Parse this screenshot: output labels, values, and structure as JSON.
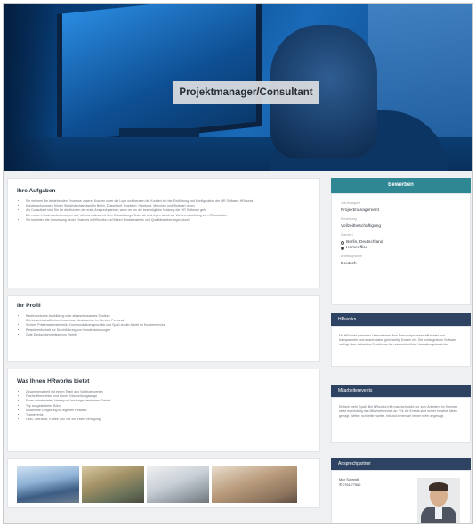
{
  "hero": {
    "title": "Projektmanager/Consultant"
  },
  "tasks": {
    "heading": "Ihre Aufgaben",
    "items": [
      "Sie nehmen die bestehenden Prozesse unserer Kunden unter die Lupe und beraten die Kunden bei der Einführung und Konfiguration der HR Software HRworks",
      "Kundenschulungen führen Sie deutschlandweit in Berlin, Düsseldorf, Frankfurt, Hamburg, München und Stuttgart durch",
      "Als Consultant sind Sie für die Kunden der erste Ansprechpartner, wenn es um die bestmögliche Nutzung der HR Software geht",
      "Die neuen Kundenanforderungen auf, stimmen diese mit dem Entwicklungs-Team ab und legen damit zur Weiterentwicklung von HRworks bei",
      "Sie begleiten die Umsetzung neuer Features in HRworks und führen Funktionstests und Qualitätssicherungen durch"
    ]
  },
  "profile": {
    "heading": "Ihr Profil",
    "items": [
      "Kaufmännische Ausbildung oder abgeschlossenes Studium",
      "Betriebswirtschaftliches Know-how, idealerweise im Bereich Personal",
      "Sichere Präsentationstechnik, Kommunikationsgeschick und Spaß an der Arbeit im Kundenservice",
      "Reisebereitschaft zur Durchführung von Kundenschulungen",
      "Gute Deutschkenntnisse von Vorteil"
    ]
  },
  "offer": {
    "heading": "Was Ihnen HRworks bietet",
    "items": [
      "Zusammenarbeit mit einem Team aus Vollblutexperten",
      "Flache Hierarchien und kurze Entscheidungswege",
      "Einen unbefristeten Vertrag mit leistungsorientiertem Gehalt",
      "Top ausgestattetes Büro",
      "Modernste Umgebung im eigenen Headset",
      "Teamevents",
      "Obst, Getränke, Kaffee und Tee zur freien Verfügung"
    ]
  },
  "apply": {
    "button_label": "Bewerben"
  },
  "details": {
    "category_label": "Job-Kategorie",
    "category_value": "Projektmanagement",
    "type_label": "Einstellung",
    "type_value": "Vollzeitbeschäftigung",
    "location_label": "Standort",
    "location_options": [
      "Berlin, Deutschland",
      "Homeoffice"
    ],
    "location_selected": 1,
    "language_label": "Arbeitssprache",
    "language_value": "Deutsch"
  },
  "about": {
    "heading": "HRworks",
    "text": "Mit HRworks gestalten Unternehmen ihre Personalprozesse effizienter und transparenter und sparen dabei gleichzeitig Kosten ein. Die umfangreiche Software verfügt über zahlreiche Funktionen für unterschiedliche Verwaltungsbereiche."
  },
  "events": {
    "heading": "Mitarbeiterevents",
    "text": "Einfach mehr Spaß: Bei HRworks trifft man sich nicht nur zum Arbeiten. Im Sommer steht regelmäßig das Mitarbeiterevent an. Für die Events sind immer kreative Ideen gefragt. Weiter, schneller, weiter, mit und lernen wir immer mehr angesagt."
  },
  "contact": {
    "heading": "Ansprechpartner",
    "name": "Max Schmidt",
    "phone": "0761/77560"
  },
  "colors": {
    "apply_button": "#2f8793",
    "sidebar_header": "#2e4361",
    "hero_tint": "#0b4f93"
  }
}
